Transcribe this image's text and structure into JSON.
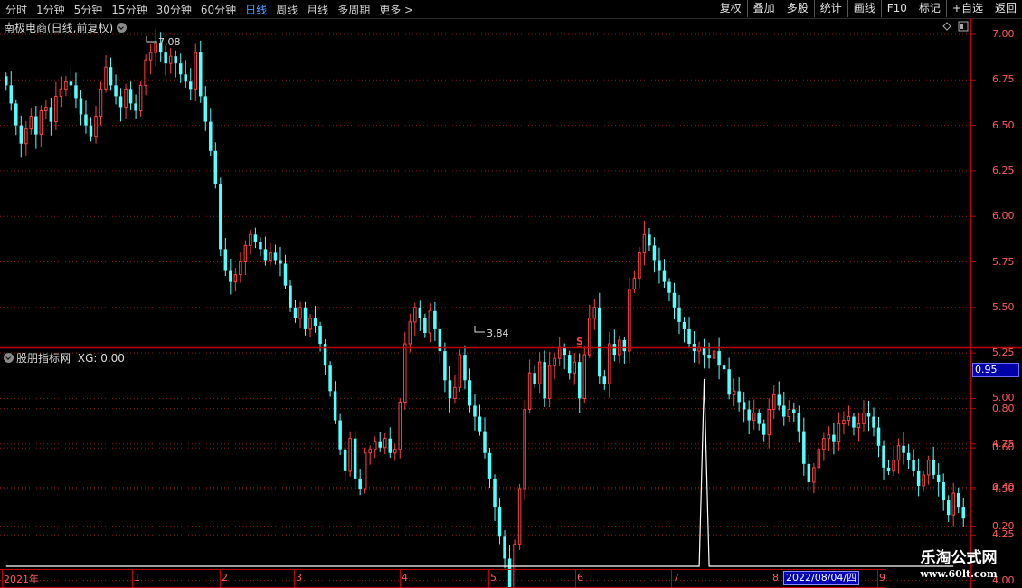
{
  "toolbar": {
    "left_items": [
      "分时",
      "1分钟",
      "5分钟",
      "15分钟",
      "30分钟",
      "60分钟",
      "日线",
      "周线",
      "月线",
      "多周期",
      "更多 >"
    ],
    "active_index": 6,
    "right_items": [
      "复权",
      "叠加",
      "多股",
      "统计",
      "画线",
      "F10",
      "标记",
      "+自选",
      "返回"
    ]
  },
  "main_panel": {
    "title": "南极电商(日线,前复权)",
    "high_label": "7.08",
    "low_label": "3.84",
    "s_marker": "S̲",
    "y_axis_ticks": [
      "7.00",
      "6.75",
      "6.50",
      "6.25",
      "6.00",
      "5.75",
      "5.50",
      "5.25",
      "5.00",
      "4.75",
      "4.50",
      "4.25",
      "4.00"
    ],
    "icons": [
      "diamond-icon",
      "window-icon"
    ]
  },
  "indicator_panel": {
    "title": "股朋指标网",
    "series_label": "XG: 0.00",
    "y_axis_ticks": [
      "0.80",
      "0.60",
      "0.40",
      "0.20"
    ],
    "current_value": "0.95"
  },
  "x_axis": {
    "labels": [
      "2021年",
      "1",
      "2",
      "3",
      "4",
      "5",
      "6",
      "7",
      "8",
      "9"
    ],
    "cursor_date": "2022/08/04/四"
  },
  "watermark": {
    "line1": "乐淘公式网",
    "line2": "www.60lt.com"
  },
  "colors": {
    "up": "#ff4040",
    "down": "#54ffff",
    "grid": "#8b1a1a",
    "axis": "#c00000",
    "signal": "#ffffff"
  },
  "chart_data": {
    "type": "candlestick",
    "ylim": [
      3.7,
      7.15
    ],
    "high": 7.08,
    "low": 3.84,
    "closes": [
      6.72,
      6.62,
      6.5,
      6.4,
      6.48,
      6.55,
      6.45,
      6.58,
      6.6,
      6.52,
      6.66,
      6.7,
      6.74,
      6.72,
      6.65,
      6.56,
      6.5,
      6.44,
      6.55,
      6.7,
      6.82,
      6.72,
      6.66,
      6.6,
      6.7,
      6.62,
      6.58,
      6.72,
      6.86,
      6.9,
      6.95,
      6.9,
      6.84,
      6.88,
      6.84,
      6.78,
      6.74,
      6.7,
      6.9,
      6.66,
      6.52,
      6.36,
      6.18,
      5.82,
      5.7,
      5.64,
      5.68,
      5.75,
      5.84,
      5.9,
      5.86,
      5.82,
      5.76,
      5.8,
      5.76,
      5.74,
      5.62,
      5.5,
      5.44,
      5.5,
      5.38,
      5.44,
      5.4,
      5.3,
      5.18,
      5.04,
      4.88,
      4.72,
      4.6,
      4.78,
      4.56,
      4.5,
      4.7,
      4.72,
      4.76,
      4.73,
      4.78,
      4.7,
      4.72,
      4.98,
      5.3,
      5.42,
      5.5,
      5.44,
      5.36,
      5.48,
      5.38,
      5.26,
      5.1,
      5.0,
      5.06,
      5.24,
      5.1,
      4.96,
      4.9,
      4.82,
      4.7,
      4.56,
      4.4,
      4.24,
      4.12,
      3.96,
      4.2,
      4.5,
      4.94,
      5.14,
      5.08,
      5.2,
      5.0,
      5.18,
      5.22,
      5.28,
      5.24,
      5.14,
      5.2,
      5.0,
      5.24,
      5.44,
      5.5,
      5.12,
      5.08,
      5.3,
      5.24,
      5.32,
      5.26,
      5.6,
      5.66,
      5.8,
      5.9,
      5.84,
      5.76,
      5.7,
      5.64,
      5.58,
      5.5,
      5.42,
      5.38,
      5.3,
      5.26,
      5.28,
      5.24,
      5.22,
      5.26,
      5.18,
      5.16,
      5.02,
      5.04,
      4.98,
      4.94,
      4.88,
      4.92,
      4.86,
      4.8,
      4.94,
      5.02,
      4.96,
      4.9,
      4.94,
      4.92,
      4.82,
      4.64,
      4.54,
      4.62,
      4.72,
      4.78,
      4.8,
      4.76,
      4.86,
      4.88,
      4.9,
      4.84,
      4.86,
      4.92,
      4.9,
      4.84,
      4.74,
      4.62,
      4.6,
      4.66,
      4.74,
      4.7,
      4.66,
      4.6,
      4.52,
      4.58,
      4.66,
      4.58,
      4.54,
      4.44,
      4.36,
      4.48,
      4.4,
      4.34
    ]
  },
  "indicator_data": {
    "type": "line",
    "ylim": [
      0,
      1.0
    ],
    "baseline": 0,
    "spike_value": 0.95,
    "spike_index": 140,
    "count": 191
  }
}
